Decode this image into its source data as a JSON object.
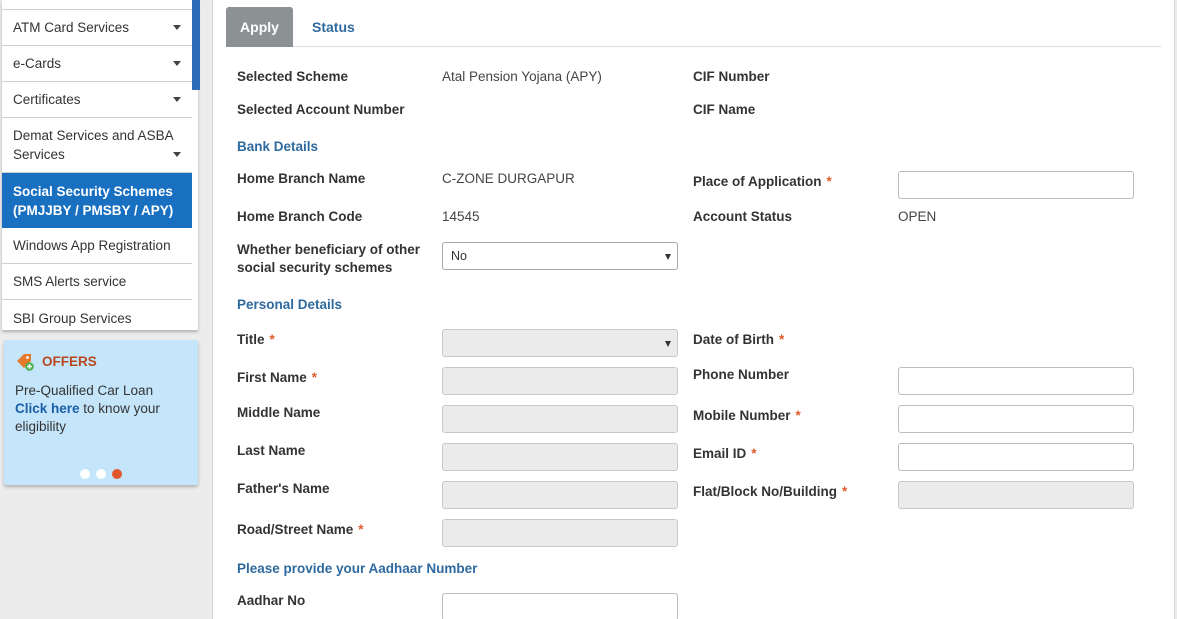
{
  "sidebar": {
    "items": [
      {
        "label": "ATM Card Services",
        "caret": true
      },
      {
        "label": "e-Cards",
        "caret": true
      },
      {
        "label": "Certificates",
        "caret": true
      },
      {
        "label": "Demat Services and ASBA Services",
        "caret": true
      },
      {
        "label": "Social Security Schemes (PMJJBY / PMSBY / APY)",
        "caret": false,
        "active": true
      },
      {
        "label": "Windows App Registration",
        "caret": false
      },
      {
        "label": "SMS Alerts service",
        "caret": false
      },
      {
        "label": "SBI Group Services",
        "caret": false
      }
    ]
  },
  "offers": {
    "title": "OFFERS",
    "line1": "Pre-Qualified Car Loan",
    "link": "Click here",
    "line2": " to know your eligibility",
    "icon": "offer-tag-icon"
  },
  "tabs": {
    "apply": "Apply",
    "status": "Status"
  },
  "summary": {
    "selected_scheme_label": "Selected Scheme",
    "selected_scheme_value": "Atal Pension Yojana (APY)",
    "cif_number_label": "CIF Number",
    "selected_account_label": "Selected Account Number",
    "cif_name_label": "CIF Name"
  },
  "bank": {
    "section": "Bank Details",
    "home_branch_name_label": "Home Branch Name",
    "home_branch_name_value": "C-ZONE DURGAPUR",
    "place_label": "Place of Application",
    "home_branch_code_label": "Home Branch Code",
    "home_branch_code_value": "14545",
    "account_status_label": "Account Status",
    "account_status_value": "OPEN",
    "beneficiary_label": "Whether beneficiary of other social security schemes",
    "beneficiary_value": "No"
  },
  "personal": {
    "section": "Personal Details",
    "title_label": "Title",
    "dob_label": "Date of Birth",
    "first_name_label": "First Name",
    "phone_label": "Phone Number",
    "middle_name_label": "Middle Name",
    "mobile_label": "Mobile Number",
    "last_name_label": "Last Name",
    "email_label": "Email ID",
    "father_label": "Father's Name",
    "flat_label": "Flat/Block No/Building",
    "road_label": "Road/Street Name"
  },
  "aadhaar": {
    "section": "Please provide your Aadhaar Number",
    "label": "Aadhar No"
  },
  "required_mark": "*"
}
